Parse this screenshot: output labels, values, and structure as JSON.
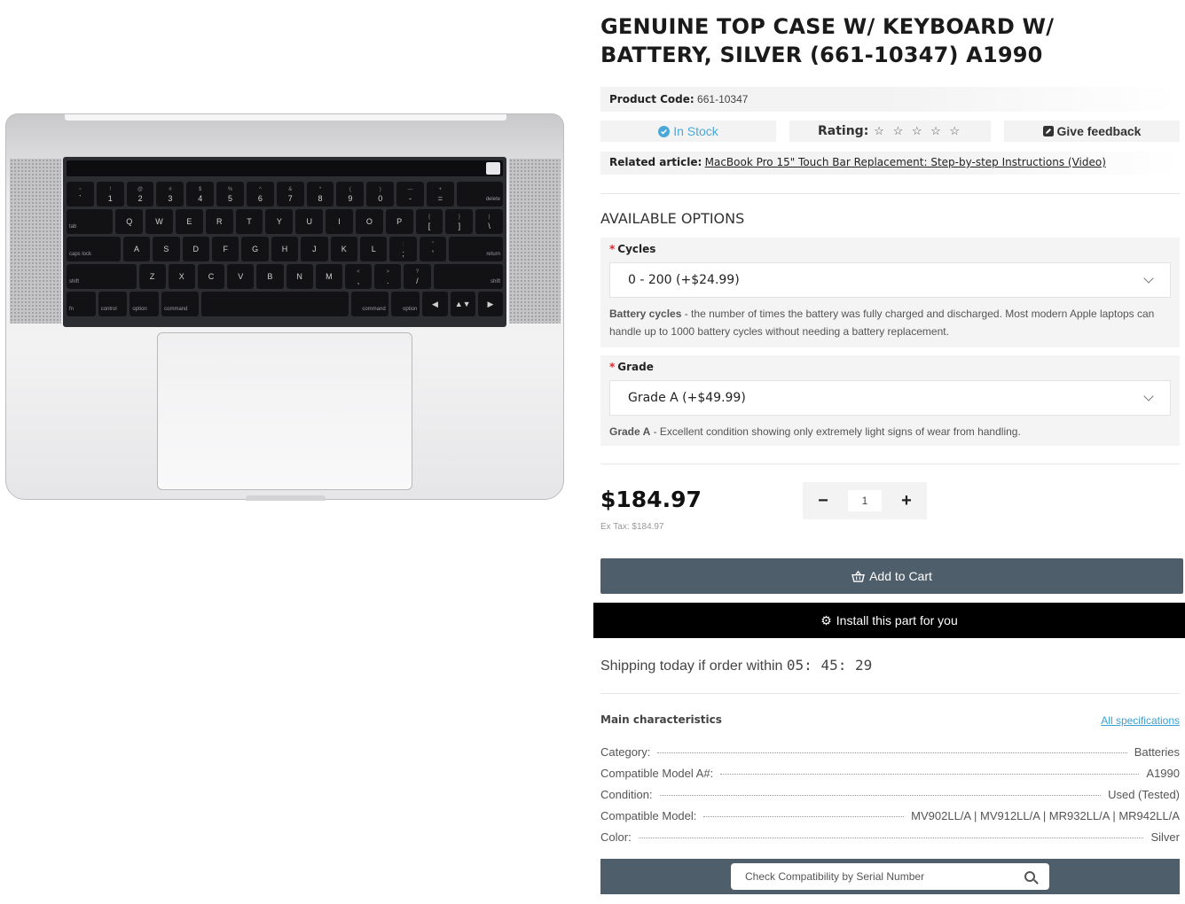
{
  "product": {
    "title": "GENUINE TOP CASE W/ KEYBOARD W/ BATTERY, SILVER (661-10347) A1990",
    "code_label": "Product Code:",
    "code_value": "661-10347",
    "stock": "In Stock",
    "rating_label": "Rating:",
    "rating_stars": "☆ ☆ ☆ ☆ ☆",
    "rating_value": 0,
    "feedback": "Give feedback",
    "related_label": "Related article:",
    "related_link": "MacBook Pro 15\" Touch Bar Replacement: Step-by-step Instructions (Video)"
  },
  "options": {
    "heading": "AVAILABLE OPTIONS",
    "cycles": {
      "label": "Cycles",
      "selected": "0 - 200 (+$24.99)",
      "desc_bold": "Battery cycles",
      "desc": " - the number of times the battery was fully charged and discharged. Most modern Apple laptops can handle up to 1000 battery cycles without needing a battery replacement."
    },
    "grade": {
      "label": "Grade",
      "selected": "Grade A (+$49.99)",
      "desc_bold": "Grade A",
      "desc": " - Excellent condition showing only extremely light signs of wear from handling."
    }
  },
  "purchase": {
    "price": "$184.97",
    "ex_tax": "Ex Tax: $184.97",
    "qty_minus": "−",
    "qty_value": "1",
    "qty_plus": "+",
    "add_to_cart": "Add to Cart",
    "install": "Install this part for you",
    "shipping_prefix": "Shipping today if order within ",
    "countdown": "05: 45: 29"
  },
  "characteristics": {
    "heading": "Main characteristics",
    "all_specs": "All specifications",
    "rows": [
      {
        "label": "Category:",
        "value": "Batteries"
      },
      {
        "label": "Compatible Model A#:",
        "value": "A1990"
      },
      {
        "label": "Condition:",
        "value": "Used (Tested)"
      },
      {
        "label": "Compatible Model:",
        "value": "MV902LL/A | MV912LL/A | MR932LL/A | MR942LL/A"
      },
      {
        "label": "Color:",
        "value": "Silver"
      }
    ]
  },
  "compat": {
    "placeholder": "Check Compatibility by Serial Number"
  },
  "colors": {
    "stock": "#4aa8d8",
    "required": "#d9262b",
    "cart_bg": "#4f5e6b",
    "install_bg": "#000000",
    "link": "#3aa0d4"
  },
  "icons": {
    "stock": "check-circle-icon",
    "feedback": "edit-icon",
    "cart": "basket-icon",
    "install": "gear-icon",
    "search": "search-icon"
  },
  "keyboard": {
    "row1": [
      "~\n`",
      "!\n1",
      "@\n2",
      "#\n3",
      "$\n4",
      "%\n5",
      "^\n6",
      "&\n7",
      "*\n8",
      "(\n9",
      ")\n0",
      "—\n-",
      "+\n=",
      "delete"
    ],
    "row2": [
      "tab",
      "Q",
      "W",
      "E",
      "R",
      "T",
      "Y",
      "U",
      "I",
      "O",
      "P",
      "{\n[",
      "}\n]",
      "|\n\\"
    ],
    "row3": [
      "caps lock",
      "A",
      "S",
      "D",
      "F",
      "G",
      "H",
      "J",
      "K",
      "L",
      ":\n;",
      "\"\n'",
      "return"
    ],
    "row4": [
      "shift",
      "Z",
      "X",
      "C",
      "V",
      "B",
      "N",
      "M",
      "<\n,",
      ">\n.",
      "?\n/",
      "shift"
    ],
    "row5": [
      "fn",
      "control",
      "option",
      "command",
      "",
      "command",
      "option",
      "◀",
      "▲▼",
      "▶"
    ]
  }
}
